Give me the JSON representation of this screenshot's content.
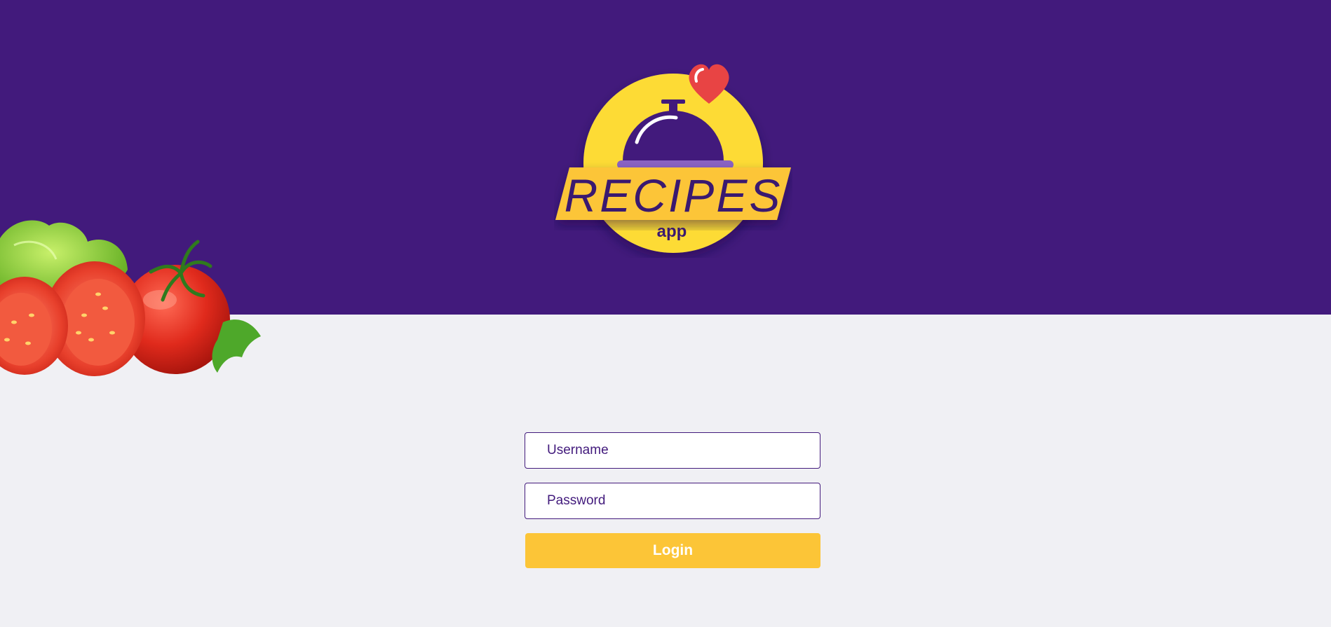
{
  "brand": {
    "word": "RECIPES",
    "sub": "app",
    "icon": "cloche-heart-logo"
  },
  "login": {
    "username_placeholder": "Username",
    "password_placeholder": "Password",
    "submit_label": "Login"
  },
  "decor": {
    "image": "tomatoes-lettuce"
  },
  "colors": {
    "header": "#421a7c",
    "background": "#f0f0f4",
    "accent": "#fcc537",
    "logo_yellow": "#fddb36",
    "heart": "#e84444"
  }
}
